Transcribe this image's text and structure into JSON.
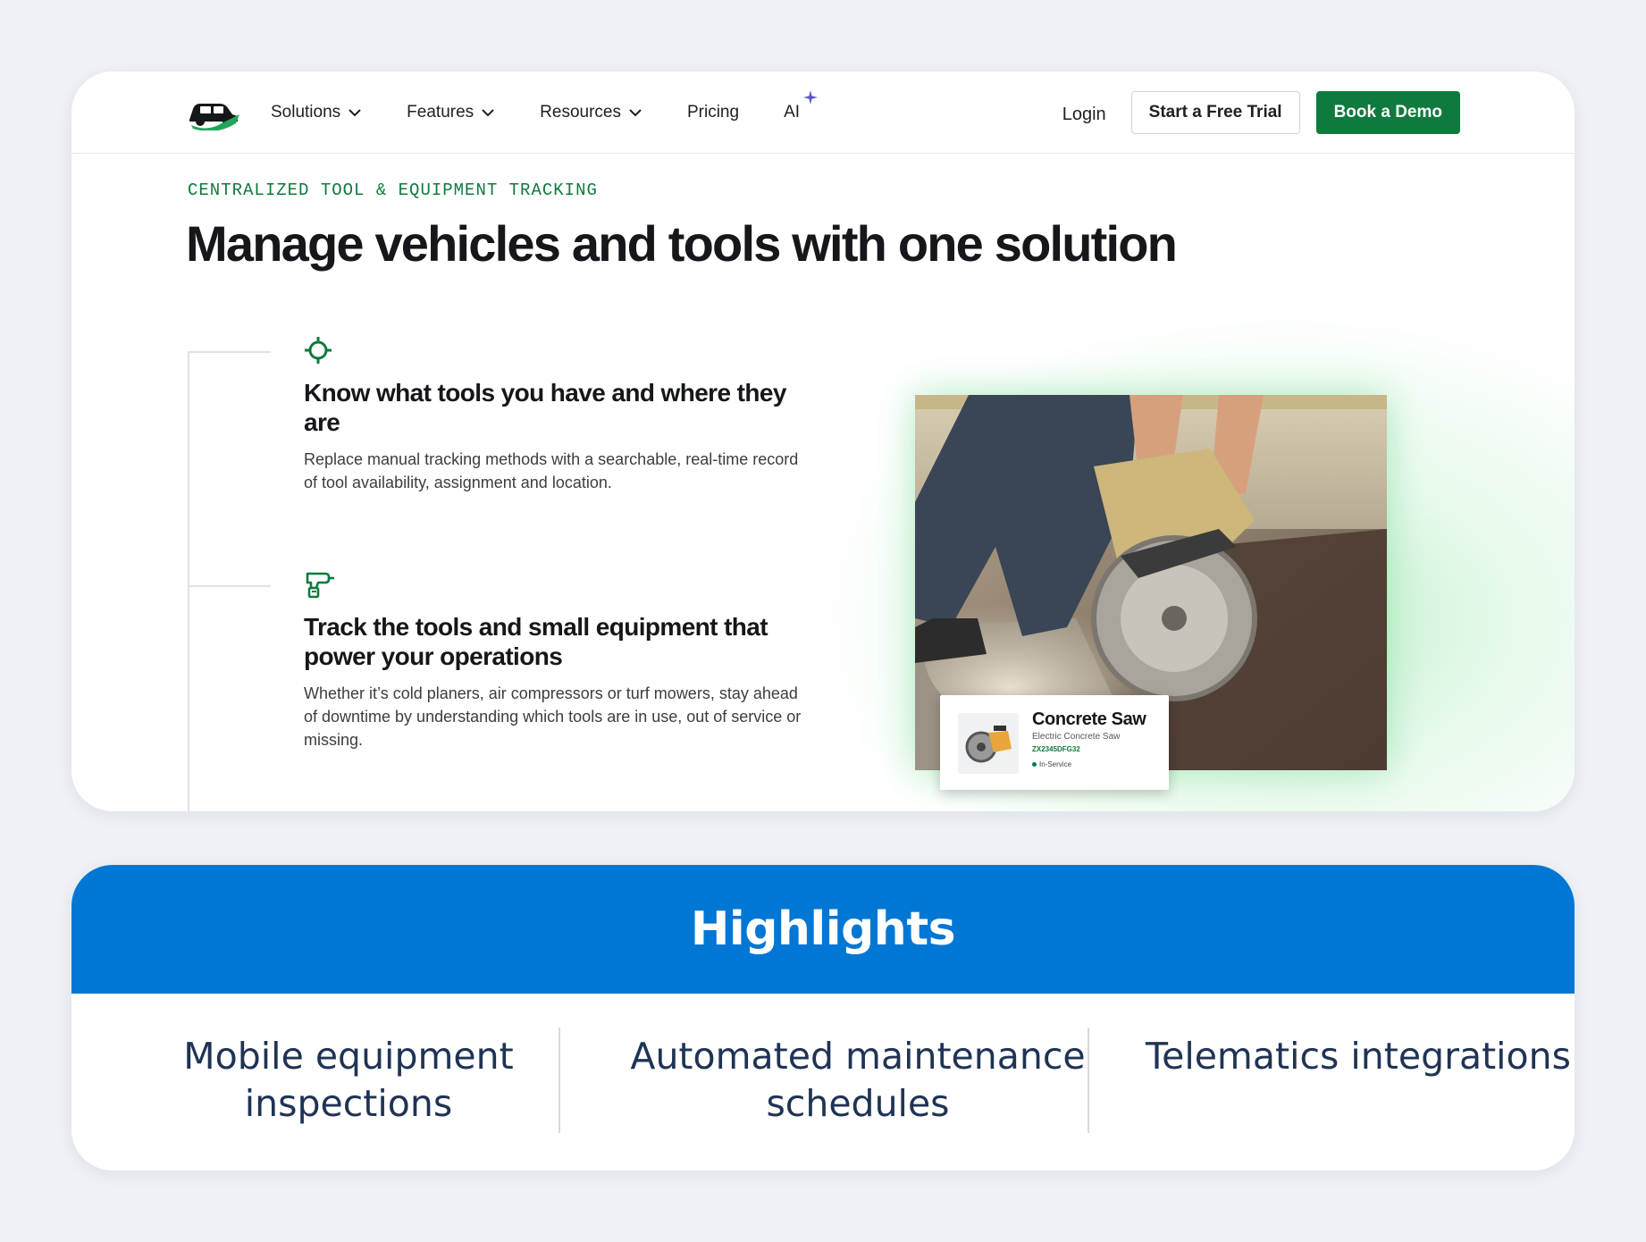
{
  "nav": {
    "items": [
      {
        "label": "Solutions",
        "dropdown": true
      },
      {
        "label": "Features",
        "dropdown": true
      },
      {
        "label": "Resources",
        "dropdown": true
      },
      {
        "label": "Pricing",
        "dropdown": false
      },
      {
        "label": "AI",
        "dropdown": false
      }
    ],
    "login_label": "Login",
    "trial_label": "Start a Free Trial",
    "demo_label": "Book a Demo"
  },
  "hero": {
    "eyebrow": "CENTRALIZED TOOL & EQUIPMENT TRACKING",
    "title": "Manage vehicles and tools with one solution"
  },
  "features": [
    {
      "icon": "crosshair-icon",
      "title": "Know what tools you have and where they are",
      "body": "Replace manual tracking methods with a searchable, real-time record of tool availability, assignment and location."
    },
    {
      "icon": "power-drill-icon",
      "title": "Track the tools and small equipment that power your operations",
      "body": "Whether it’s cold planers, air compressors or turf mowers, stay ahead of downtime by understanding which tools are in use, out of service or missing."
    }
  ],
  "asset_card": {
    "name": "Concrete Saw",
    "type": "Electric Concrete Saw",
    "id": "ZX2345DFG32",
    "status": "In-Service"
  },
  "highlights": {
    "title": "Highlights",
    "items": [
      "Mobile equipment inspections",
      "Automated maintenance schedules",
      "Telematics integrations"
    ]
  },
  "colors": {
    "brand_green": "#0f7a3e",
    "highlight_blue": "#0077d4",
    "highlight_text": "#1f3354",
    "page_bg": "#eef1f5"
  }
}
